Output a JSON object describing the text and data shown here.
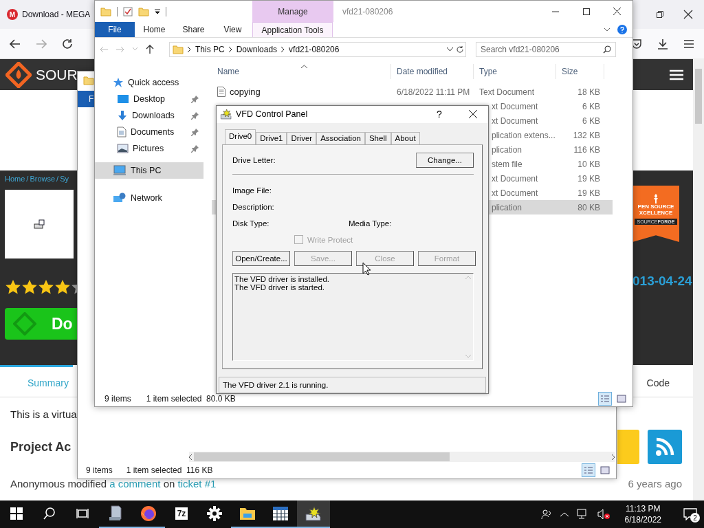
{
  "browser": {
    "tab": {
      "title": "Download - MEGA",
      "icon_text": "M",
      "selected": true
    }
  },
  "site": {
    "logo": "SOUR",
    "breadcrumb": [
      "Home",
      "Browse",
      "Sy"
    ],
    "breadcrumb_separator": "/",
    "stars": 4,
    "download_label": "Do",
    "badge_lines": [
      "PEN SOURCE",
      "XCELLENCE"
    ],
    "badge_brand": "SOURCE**FORGE**",
    "date": "013-04-24",
    "tabs": [
      {
        "label": "Summary",
        "selected": true
      },
      {
        "label": "Code",
        "selected": false
      }
    ],
    "description": "This is a virtua",
    "section_title": "Project Ac",
    "activity": {
      "text": "Anonymous modified",
      "link": "a comment",
      "middle": "on",
      "ticket": "ticket #1",
      "time": "6 years ago"
    }
  },
  "back_window": {
    "ribbon_tab": "F",
    "status": {
      "items": "9 items",
      "selected": "1 item selected",
      "size": "116 KB"
    }
  },
  "explorer": {
    "title": "vfd21-080206",
    "context_tab": "Manage",
    "ribbon_tabs": [
      {
        "label": "File",
        "kind": "file"
      },
      {
        "label": "Home",
        "kind": "tab"
      },
      {
        "label": "Share",
        "kind": "tab"
      },
      {
        "label": "View",
        "kind": "tab"
      },
      {
        "label": "Application Tools",
        "kind": "context"
      }
    ],
    "path": [
      "This PC",
      "Downloads",
      "vfd21-080206"
    ],
    "search_placeholder": "Search vfd21-080206",
    "nav": [
      {
        "label": "Quick access",
        "selected": false,
        "children": [
          {
            "label": "Desktop",
            "pinned": true,
            "selected": false
          },
          {
            "label": "Downloads",
            "pinned": true,
            "selected": false
          },
          {
            "label": "Documents",
            "pinned": true,
            "selected": false
          },
          {
            "label": "Pictures",
            "pinned": true,
            "selected": false
          }
        ]
      },
      {
        "label": "This PC",
        "selected": true
      },
      {
        "label": "Network",
        "selected": false
      }
    ],
    "columns": [
      {
        "label": "Name",
        "sorted": true
      },
      {
        "label": "Date modified",
        "sorted": false
      },
      {
        "label": "Type",
        "sorted": false
      },
      {
        "label": "Size",
        "sorted": false
      }
    ],
    "rows": [
      {
        "name": "copying",
        "date": "6/18/2022 11:11 PM",
        "type": "Text Document",
        "size": "18 KB",
        "selected": false
      },
      {
        "type": "xt Document",
        "size": "6 KB",
        "selected": false
      },
      {
        "type": "xt Document",
        "size": "6 KB",
        "selected": false
      },
      {
        "type": "plication extens...",
        "size": "132 KB",
        "selected": false
      },
      {
        "type": "plication",
        "size": "116 KB",
        "selected": false
      },
      {
        "type": "stem file",
        "size": "10 KB",
        "selected": false
      },
      {
        "type": "xt Document",
        "size": "19 KB",
        "selected": false
      },
      {
        "type": "xt Document",
        "size": "19 KB",
        "selected": false
      },
      {
        "type": "plication",
        "size": "80 KB",
        "selected": true
      }
    ],
    "status": {
      "items": "9 items",
      "selected": "1 item selected",
      "size": "80.0 KB"
    },
    "views": [
      {
        "kind": "details",
        "selected": true
      },
      {
        "kind": "preview",
        "selected": false
      }
    ]
  },
  "dialog": {
    "title": "VFD Control Panel",
    "help": "?",
    "tabs": [
      {
        "label": "Drive0",
        "selected": true
      },
      {
        "label": "Drive1",
        "selected": false
      },
      {
        "label": "Driver",
        "selected": false
      },
      {
        "label": "Association",
        "selected": false
      },
      {
        "label": "Shell",
        "selected": false
      },
      {
        "label": "About",
        "selected": false
      }
    ],
    "drive_letter": "Drive Letter:",
    "change": "Change...",
    "image_file": "Image File:",
    "description": "Description:",
    "disk_type": "Disk Type:",
    "media_type": "Media Type:",
    "write_protect": {
      "label": "Write Protect",
      "checked": false,
      "disabled": true
    },
    "buttons": [
      {
        "label": "Open/Create...",
        "disabled": false
      },
      {
        "label": "Save...",
        "disabled": true
      },
      {
        "label": "Close",
        "disabled": true
      },
      {
        "label": "Format",
        "disabled": true
      }
    ],
    "log": [
      "The VFD driver is installed.",
      "The VFD driver is started."
    ],
    "status": "The VFD driver 2.1 is running."
  },
  "taskbar": {
    "items": [
      {
        "kind": "start",
        "open": false,
        "selected": false
      },
      {
        "kind": "search",
        "open": false,
        "selected": false
      },
      {
        "kind": "taskview",
        "open": false,
        "selected": false
      },
      {
        "kind": "server",
        "open": true,
        "selected": false
      },
      {
        "kind": "browser",
        "open": true,
        "selected": false
      },
      {
        "kind": "archiver",
        "label": "7z",
        "open": false,
        "selected": false
      },
      {
        "kind": "gear",
        "open": false,
        "selected": false
      },
      {
        "kind": "folder",
        "open": true,
        "selected": false
      },
      {
        "kind": "calculator",
        "open": true,
        "selected": false
      },
      {
        "kind": "drive",
        "open": true,
        "selected": true
      }
    ],
    "time": "11:13 PM",
    "date": "6/18/2022",
    "notifications": "2"
  }
}
